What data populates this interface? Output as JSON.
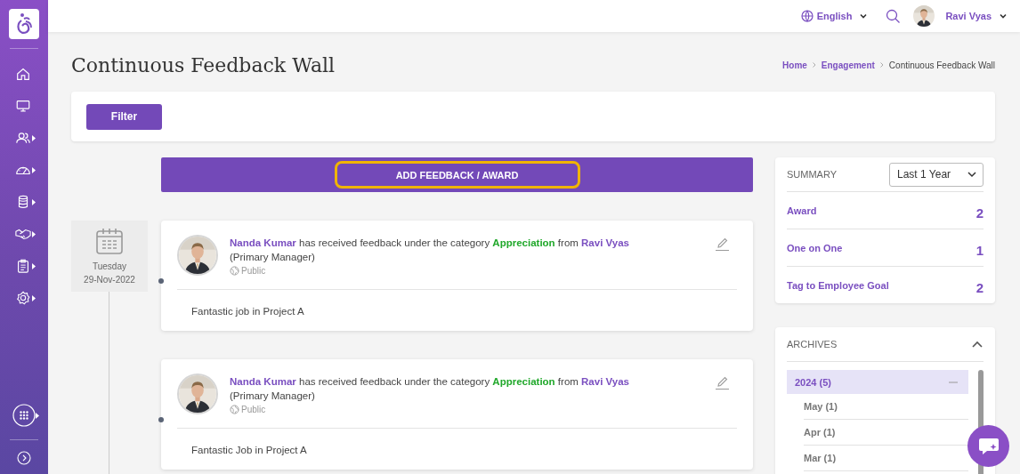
{
  "topbar": {
    "language": "English",
    "user": {
      "name": "Ravi Vyas"
    }
  },
  "page": {
    "title": "Continuous Feedback Wall",
    "breadcrumbs": [
      {
        "label": "Home",
        "current": false
      },
      {
        "label": "Engagement",
        "current": false
      },
      {
        "label": "Continuous Feedback Wall",
        "current": true
      }
    ]
  },
  "filter_button": "Filter",
  "add_button": {
    "label": "ADD FEEDBACK / AWARD",
    "focused": true
  },
  "feed": [
    {
      "date": {
        "day": "Tuesday",
        "date": "29-Nov-2022"
      },
      "recipient": "Nanda Kumar",
      "text_1": "has received feedback under the category",
      "category": "Appreciation",
      "text_2": "from",
      "giver": "Ravi Vyas",
      "giver_role": "(Primary Manager)",
      "visibility": "Public",
      "message": "Fantastic job in Project A"
    },
    {
      "recipient": "Nanda Kumar",
      "text_1": "has received feedback under the category",
      "category": "Appreciation",
      "text_2": "from",
      "giver": "Ravi Vyas",
      "giver_role": "(Primary Manager)",
      "visibility": "Public",
      "message": "Fantastic Job in Project A"
    }
  ],
  "summary": {
    "title": "SUMMARY",
    "period": "Last 1 Year",
    "rows": [
      {
        "label": "Award",
        "count": "2"
      },
      {
        "label": "One on One",
        "count": "1"
      },
      {
        "label": "Tag to Employee Goal",
        "count": "2"
      }
    ]
  },
  "archives": {
    "title": "ARCHIVES",
    "expanded": true,
    "years": [
      {
        "label": "2024 (5)",
        "selected": true,
        "expanded": true,
        "children": [
          {
            "label": "May (1)"
          },
          {
            "label": "Apr (1)"
          },
          {
            "label": "Mar (1)"
          }
        ]
      }
    ]
  }
}
